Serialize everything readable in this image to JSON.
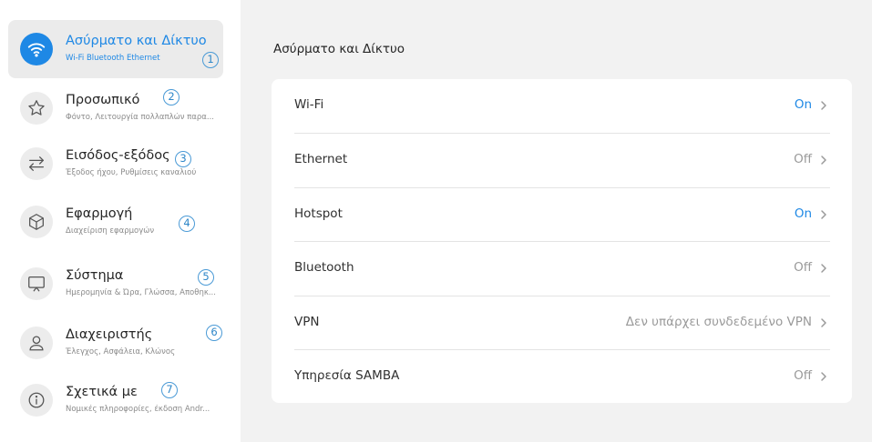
{
  "sidebar": {
    "items": [
      {
        "title": "Ασύρματο και Δίκτυο",
        "subtitle": "Wi-Fi Bluetooth Ethernet",
        "badge": "1",
        "icon": "wifi-icon"
      },
      {
        "title": "Προσωπικό",
        "subtitle": "Φόντο, Λειτουργία πολλαπλών παρα...",
        "badge": "2",
        "icon": "star-icon"
      },
      {
        "title": "Εισόδος-εξόδος",
        "subtitle": "Έξοδος ήχου, Ρυθμίσεις καναλιού",
        "badge": "3",
        "icon": "swap-arrows-icon"
      },
      {
        "title": "Εφαρμογή",
        "subtitle": "Διαχείριση εφαρμογών",
        "badge": "4",
        "icon": "cube-icon"
      },
      {
        "title": "Σύστημα",
        "subtitle": "Ημερομηνία & Ώρα, Γλώσσα, Αποθηκ...",
        "badge": "5",
        "icon": "monitor-icon"
      },
      {
        "title": "Διαχειριστής",
        "subtitle": "Έλεγχος, Ασφάλεια, Κλώνος",
        "badge": "6",
        "icon": "user-icon"
      },
      {
        "title": "Σχετικά με",
        "subtitle": "Νομικές πληροφορίες, έκδοση Andr...",
        "badge": "7",
        "icon": "info-icon"
      }
    ]
  },
  "main": {
    "title": "Ασύρματο και Δίκτυο",
    "rows": [
      {
        "label": "Wi-Fi",
        "value": "On"
      },
      {
        "label": "Ethernet",
        "value": "Off"
      },
      {
        "label": "Hotspot",
        "value": "On"
      },
      {
        "label": "Bluetooth",
        "value": "Off"
      },
      {
        "label": "VPN",
        "value": "Δεν υπάρχει συνδεδεμένο VPN"
      },
      {
        "label": "Υπηρεσία SAMBA",
        "value": "Off"
      }
    ]
  },
  "colors": {
    "accent": "#1e88e5",
    "badge": "#4a9ad6",
    "muted": "#9a9a9a"
  }
}
